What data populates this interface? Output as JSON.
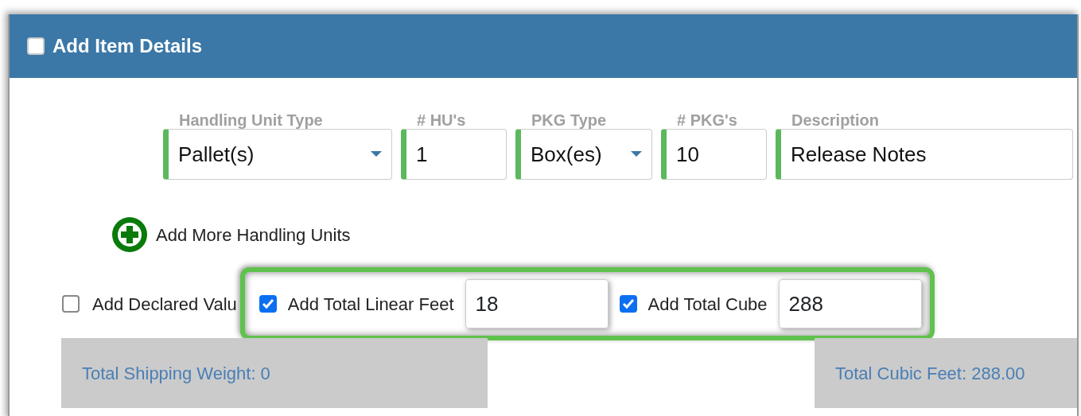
{
  "panel": {
    "title": "Add Item Details",
    "checked": false
  },
  "fields": [
    {
      "label": "Handling Unit Type",
      "kind": "select",
      "value": "Pallet(s)"
    },
    {
      "label": "# HU's",
      "kind": "text",
      "value": "1"
    },
    {
      "label": "PKG Type",
      "kind": "select",
      "value": "Box(es)"
    },
    {
      "label": "# PKG's",
      "kind": "text",
      "value": "10"
    },
    {
      "label": "Description",
      "kind": "text",
      "value": "Release Notes"
    }
  ],
  "add_more": {
    "label": "Add More Handling Units"
  },
  "declared_value": {
    "label": "Add Declared Valu",
    "checked": false
  },
  "highlighted_options": [
    {
      "label": "Add Total Linear Feet",
      "checked": true,
      "value": "18"
    },
    {
      "label": "Add Total Cube",
      "checked": true,
      "value": "288"
    }
  ],
  "totals": [
    "Total Shipping Weight: 0",
    "Total Cubic Feet: 288.00"
  ]
}
